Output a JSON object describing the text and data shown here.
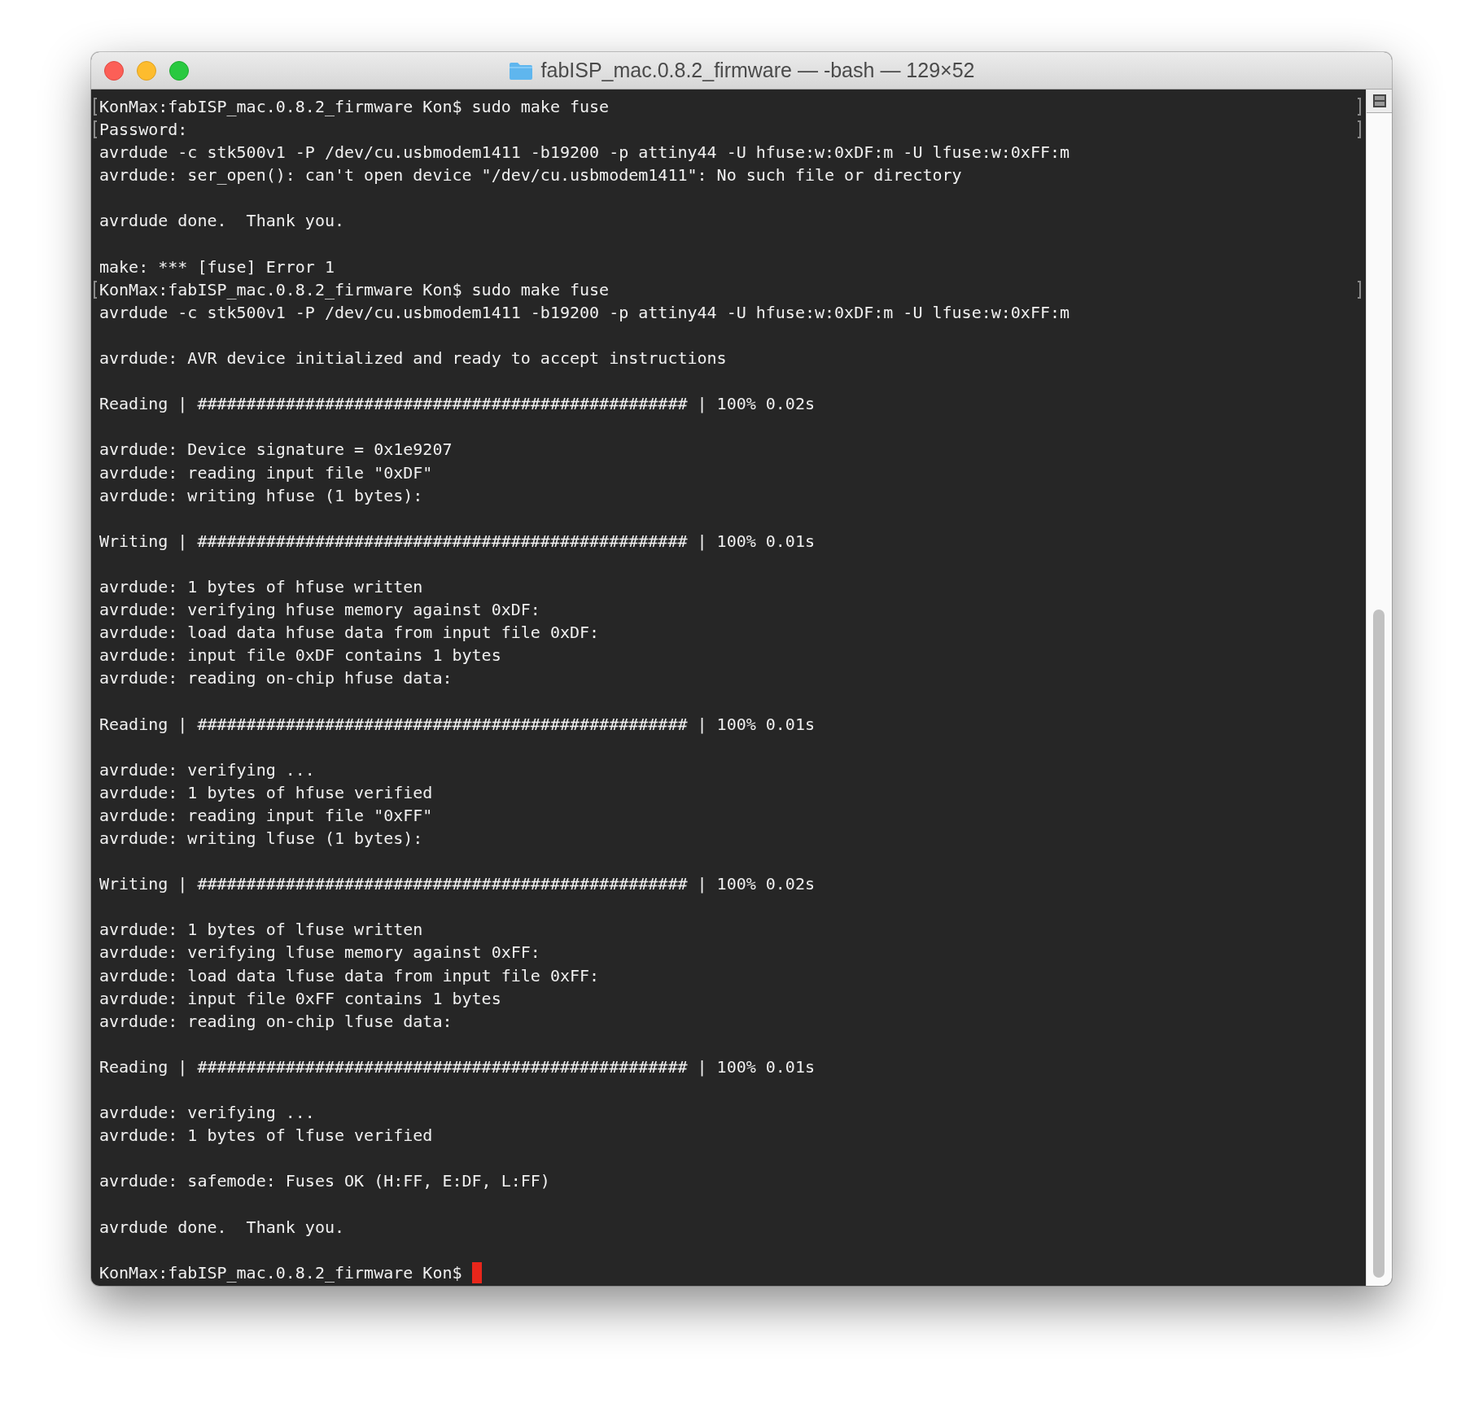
{
  "window": {
    "title": "fabISP_mac.0.8.2_firmware — -bash — 129×52"
  },
  "terminal": {
    "lines": [
      {
        "kind": "text",
        "text": "KonMax:fabISP_mac.0.8.2_firmware Kon$ sudo make fuse",
        "marked": true,
        "cursor": false
      },
      {
        "kind": "text",
        "text": "Password:",
        "marked": true,
        "cursor": false
      },
      {
        "kind": "text",
        "text": "avrdude -c stk500v1 -P /dev/cu.usbmodem1411 -b19200 -p attiny44 -U hfuse:w:0xDF:m -U lfuse:w:0xFF:m",
        "marked": false,
        "cursor": false
      },
      {
        "kind": "text",
        "text": "avrdude: ser_open(): can't open device \"/dev/cu.usbmodem1411\": No such file or directory",
        "marked": false,
        "cursor": false
      },
      {
        "kind": "blank",
        "marked": false,
        "cursor": false
      },
      {
        "kind": "text",
        "text": "avrdude done.  Thank you.",
        "marked": false,
        "cursor": false
      },
      {
        "kind": "blank",
        "marked": false,
        "cursor": false
      },
      {
        "kind": "text",
        "text": "make: *** [fuse] Error 1",
        "marked": false,
        "cursor": false
      },
      {
        "kind": "text",
        "text": "KonMax:fabISP_mac.0.8.2_firmware Kon$ sudo make fuse",
        "marked": true,
        "cursor": false
      },
      {
        "kind": "text",
        "text": "avrdude -c stk500v1 -P /dev/cu.usbmodem1411 -b19200 -p attiny44 -U hfuse:w:0xDF:m -U lfuse:w:0xFF:m",
        "marked": false,
        "cursor": false
      },
      {
        "kind": "blank",
        "marked": false,
        "cursor": false
      },
      {
        "kind": "text",
        "text": "avrdude: AVR device initialized and ready to accept instructions",
        "marked": false,
        "cursor": false
      },
      {
        "kind": "blank",
        "marked": false,
        "cursor": false
      },
      {
        "kind": "text",
        "text": "Reading | ################################################## | 100% 0.02s",
        "marked": false,
        "cursor": false
      },
      {
        "kind": "blank",
        "marked": false,
        "cursor": false
      },
      {
        "kind": "text",
        "text": "avrdude: Device signature = 0x1e9207",
        "marked": false,
        "cursor": false
      },
      {
        "kind": "text",
        "text": "avrdude: reading input file \"0xDF\"",
        "marked": false,
        "cursor": false
      },
      {
        "kind": "text",
        "text": "avrdude: writing hfuse (1 bytes):",
        "marked": false,
        "cursor": false
      },
      {
        "kind": "blank",
        "marked": false,
        "cursor": false
      },
      {
        "kind": "text",
        "text": "Writing | ################################################## | 100% 0.01s",
        "marked": false,
        "cursor": false
      },
      {
        "kind": "blank",
        "marked": false,
        "cursor": false
      },
      {
        "kind": "text",
        "text": "avrdude: 1 bytes of hfuse written",
        "marked": false,
        "cursor": false
      },
      {
        "kind": "text",
        "text": "avrdude: verifying hfuse memory against 0xDF:",
        "marked": false,
        "cursor": false
      },
      {
        "kind": "text",
        "text": "avrdude: load data hfuse data from input file 0xDF:",
        "marked": false,
        "cursor": false
      },
      {
        "kind": "text",
        "text": "avrdude: input file 0xDF contains 1 bytes",
        "marked": false,
        "cursor": false
      },
      {
        "kind": "text",
        "text": "avrdude: reading on-chip hfuse data:",
        "marked": false,
        "cursor": false
      },
      {
        "kind": "blank",
        "marked": false,
        "cursor": false
      },
      {
        "kind": "text",
        "text": "Reading | ################################################## | 100% 0.01s",
        "marked": false,
        "cursor": false
      },
      {
        "kind": "blank",
        "marked": false,
        "cursor": false
      },
      {
        "kind": "text",
        "text": "avrdude: verifying ...",
        "marked": false,
        "cursor": false
      },
      {
        "kind": "text",
        "text": "avrdude: 1 bytes of hfuse verified",
        "marked": false,
        "cursor": false
      },
      {
        "kind": "text",
        "text": "avrdude: reading input file \"0xFF\"",
        "marked": false,
        "cursor": false
      },
      {
        "kind": "text",
        "text": "avrdude: writing lfuse (1 bytes):",
        "marked": false,
        "cursor": false
      },
      {
        "kind": "blank",
        "marked": false,
        "cursor": false
      },
      {
        "kind": "text",
        "text": "Writing | ################################################## | 100% 0.02s",
        "marked": false,
        "cursor": false
      },
      {
        "kind": "blank",
        "marked": false,
        "cursor": false
      },
      {
        "kind": "text",
        "text": "avrdude: 1 bytes of lfuse written",
        "marked": false,
        "cursor": false
      },
      {
        "kind": "text",
        "text": "avrdude: verifying lfuse memory against 0xFF:",
        "marked": false,
        "cursor": false
      },
      {
        "kind": "text",
        "text": "avrdude: load data lfuse data from input file 0xFF:",
        "marked": false,
        "cursor": false
      },
      {
        "kind": "text",
        "text": "avrdude: input file 0xFF contains 1 bytes",
        "marked": false,
        "cursor": false
      },
      {
        "kind": "text",
        "text": "avrdude: reading on-chip lfuse data:",
        "marked": false,
        "cursor": false
      },
      {
        "kind": "blank",
        "marked": false,
        "cursor": false
      },
      {
        "kind": "text",
        "text": "Reading | ################################################## | 100% 0.01s",
        "marked": false,
        "cursor": false
      },
      {
        "kind": "blank",
        "marked": false,
        "cursor": false
      },
      {
        "kind": "text",
        "text": "avrdude: verifying ...",
        "marked": false,
        "cursor": false
      },
      {
        "kind": "text",
        "text": "avrdude: 1 bytes of lfuse verified",
        "marked": false,
        "cursor": false
      },
      {
        "kind": "blank",
        "marked": false,
        "cursor": false
      },
      {
        "kind": "text",
        "text": "avrdude: safemode: Fuses OK (H:FF, E:DF, L:FF)",
        "marked": false,
        "cursor": false
      },
      {
        "kind": "blank",
        "marked": false,
        "cursor": false
      },
      {
        "kind": "text",
        "text": "avrdude done.  Thank you.",
        "marked": false,
        "cursor": false
      },
      {
        "kind": "blank",
        "marked": false,
        "cursor": false
      },
      {
        "kind": "text",
        "text": "KonMax:fabISP_mac.0.8.2_firmware Kon$",
        "marked": false,
        "cursor": true
      }
    ]
  }
}
